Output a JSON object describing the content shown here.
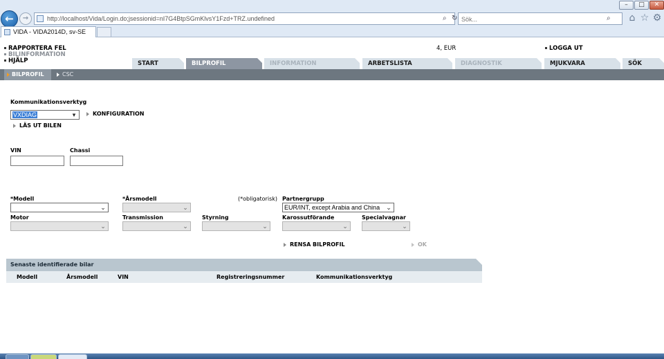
{
  "browser": {
    "url": "http://localhost/Vida/Login.do;jsessionid=nI7G4BtpSGmKlvsY1Fzd+TRZ.undefined",
    "search_placeholder": "Sök...",
    "search_glyph": "⌕",
    "refresh_glyph": "↻",
    "tab_title": "VIDA - VIDA2014D, sv-SE",
    "back_glyph": "←",
    "forward_glyph": "→",
    "window_controls": {
      "minimize": "–",
      "maximize": "□",
      "close": "✕"
    },
    "toolbar_icons": {
      "home": "⌂",
      "favorites": "☆",
      "settings": "⚙"
    }
  },
  "header": {
    "links": [
      "RAPPORTERA FEL",
      "BILINFORMATION",
      "HJÄLP"
    ],
    "cart_info": "4, EUR",
    "logout": "LOGGA UT"
  },
  "main_tabs": [
    {
      "label": "START",
      "state": "normal"
    },
    {
      "label": "BILPROFIL",
      "state": "active"
    },
    {
      "label": "INFORMATION",
      "state": "disabled"
    },
    {
      "label": "ARBETSLISTA",
      "state": "normal"
    },
    {
      "label": "DIAGNOSTIK",
      "state": "disabled"
    },
    {
      "label": "MJUKVARA",
      "state": "normal"
    },
    {
      "label": "SÖK",
      "state": "normal"
    }
  ],
  "sub_tabs": [
    "BILPROFIL",
    "CSC"
  ],
  "form": {
    "komm_label": "Kommunikationsverktyg",
    "komm_value": "VXDIAG",
    "konfiguration": "KONFIGURATION",
    "las_ut": "LÄS UT BILEN",
    "vin_label": "VIN",
    "chassi_label": "Chassi",
    "modell_label": "*Modell",
    "arsmodell_label": "*Årsmodell",
    "hint": "(*obligatorisk)",
    "partnergrupp_label": "Partnergrupp",
    "partnergrupp_value": "EUR/INT, except Arabia and China",
    "motor_label": "Motor",
    "transmission_label": "Transmission",
    "styrning_label": "Styrning",
    "karossutforande_label": "Karossutförande",
    "specialvagnar_label": "Specialvagnar",
    "rensa": "RENSA BILPROFIL",
    "ok": "OK"
  },
  "recent": {
    "title": "Senaste identifierade bilar",
    "columns": [
      "Modell",
      "Årsmodell",
      "VIN",
      "Registreringsnummer",
      "Kommunikationsverktyg"
    ]
  },
  "colors": {
    "active_tab": "#8d96a2",
    "tab_bg": "#d8e1e8",
    "sub_bar": "#6d7780",
    "accent_orange": "#f39b20",
    "selection_blue": "#3c7fd6"
  }
}
